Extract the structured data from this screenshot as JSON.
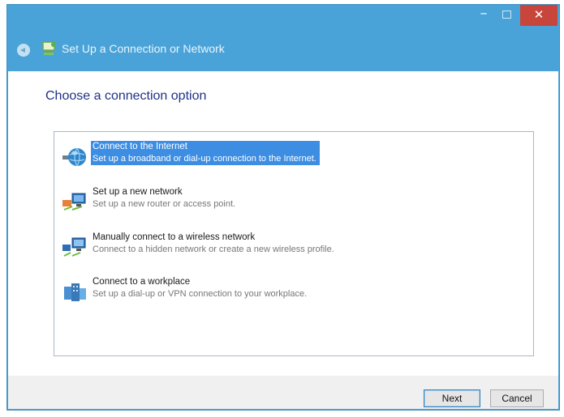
{
  "window": {
    "title": "Set Up a Connection or Network",
    "controls": {
      "minimize": "–",
      "close": "✕"
    }
  },
  "main": {
    "heading": "Choose a connection option",
    "options": [
      {
        "title": "Connect to the Internet",
        "description": "Set up a broadband or dial-up connection to the Internet.",
        "icon": "globe-network-icon",
        "selected": true
      },
      {
        "title": "Set up a new network",
        "description": "Set up a new router or access point.",
        "icon": "router-network-icon",
        "selected": false
      },
      {
        "title": "Manually connect to a wireless network",
        "description": "Connect to a hidden network or create a new wireless profile.",
        "icon": "wireless-network-icon",
        "selected": false
      },
      {
        "title": "Connect to a workplace",
        "description": "Set up a dial-up or VPN connection to your workplace.",
        "icon": "workplace-icon",
        "selected": false
      }
    ]
  },
  "footer": {
    "next_label": "Next",
    "cancel_label": "Cancel"
  },
  "colors": {
    "titlebar": "#4aa3d8",
    "selection": "#3d8ee3",
    "heading": "#1e3287",
    "close": "#c7453b"
  }
}
